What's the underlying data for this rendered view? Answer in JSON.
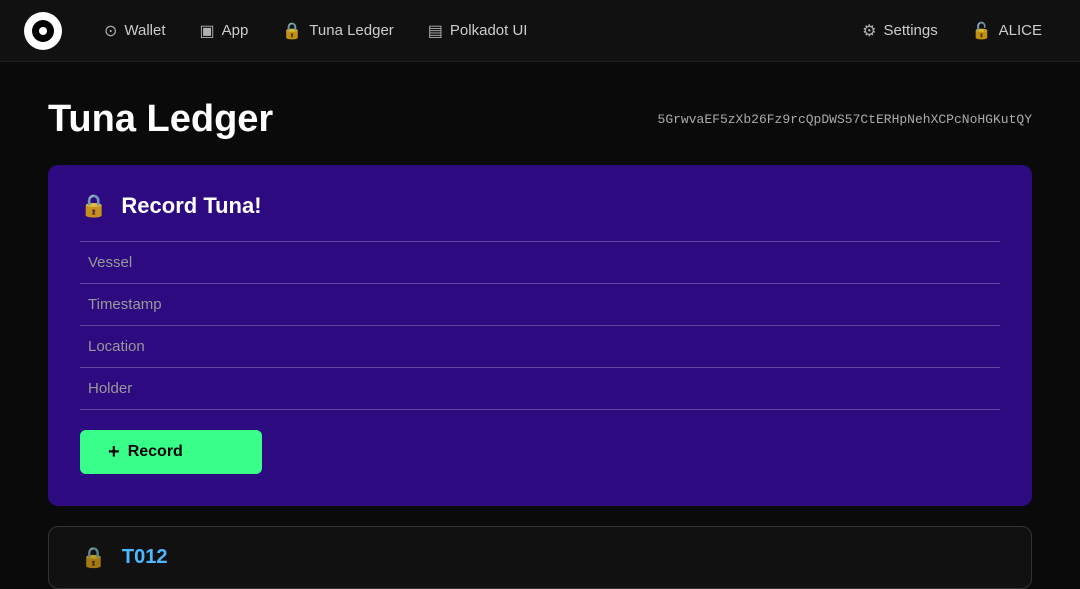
{
  "nav": {
    "logo_alt": "Polkadot logo",
    "items": [
      {
        "id": "wallet",
        "icon": "⊙",
        "label": "Wallet"
      },
      {
        "id": "app",
        "icon": "⬛",
        "label": "App"
      },
      {
        "id": "tuna-ledger",
        "icon": "🔒",
        "label": "Tuna Ledger"
      },
      {
        "id": "polkadot-ui",
        "icon": "☰",
        "label": "Polkadot UI"
      }
    ],
    "right_items": [
      {
        "id": "settings",
        "icon": "⚙",
        "label": "Settings"
      },
      {
        "id": "alice",
        "icon": "🔓",
        "label": "ALICE"
      }
    ]
  },
  "page": {
    "title": "Tuna Ledger",
    "address": "5GrwvaEF5zXb26Fz9rcQpDWS57CtERHpNehXCPcNoHGKutQY"
  },
  "form_card": {
    "title": "Record Tuna!",
    "fields": [
      {
        "id": "vessel",
        "placeholder": "Vessel"
      },
      {
        "id": "timestamp",
        "placeholder": "Timestamp"
      },
      {
        "id": "location",
        "placeholder": "Location"
      },
      {
        "id": "holder",
        "placeholder": "Holder"
      }
    ],
    "button": {
      "plus": "+",
      "label": "Record"
    }
  },
  "bottom_card": {
    "id": "T012"
  }
}
